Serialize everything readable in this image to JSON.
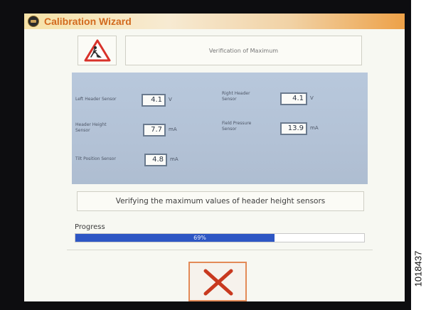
{
  "window": {
    "title": "Calibration Wizard",
    "logo_icon": "company-logo-icon"
  },
  "step": {
    "icon": "warning-triangle-icon",
    "title": "Verification of Maximum"
  },
  "sensors": [
    {
      "label": "Left Header Sensor",
      "value": "4.1",
      "unit": "V"
    },
    {
      "label": "Right Header Sensor",
      "value": "4.1",
      "unit": "V"
    },
    {
      "label": "Header Height Sensor",
      "value": "7.7",
      "unit": "mA"
    },
    {
      "label": "Field Pressure Sensor",
      "value": "13.9",
      "unit": "mA"
    },
    {
      "label": "Tilt Position Sensor",
      "value": "4.8",
      "unit": "mA"
    }
  ],
  "status": "Verifying the maximum values of header height sensors",
  "progress": {
    "label": "Progress",
    "percent": 69,
    "text": "69%"
  },
  "cancel": {
    "icon": "close-x-icon"
  },
  "figure_number": "1018437",
  "colors": {
    "title_text": "#d26a1e",
    "progress_fill": "#2d56c4",
    "cancel_x": "#c8391f",
    "panel_bg": "#b6c5d9"
  }
}
